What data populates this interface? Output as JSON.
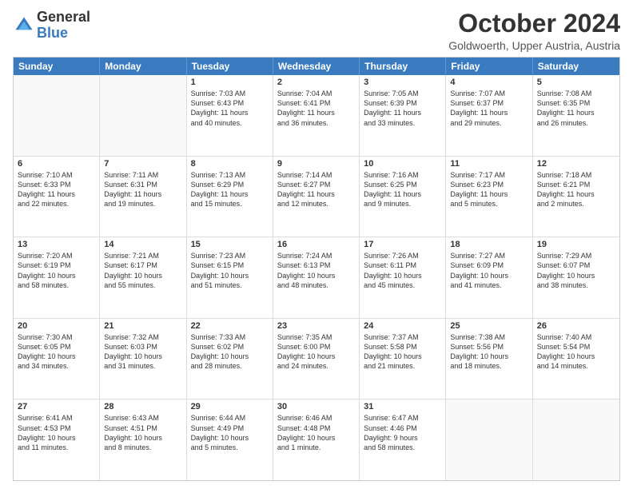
{
  "header": {
    "logo_general": "General",
    "logo_blue": "Blue",
    "month_title": "October 2024",
    "location": "Goldwoerth, Upper Austria, Austria"
  },
  "days_of_week": [
    "Sunday",
    "Monday",
    "Tuesday",
    "Wednesday",
    "Thursday",
    "Friday",
    "Saturday"
  ],
  "weeks": [
    [
      {
        "day": "",
        "empty": true,
        "lines": []
      },
      {
        "day": "",
        "empty": true,
        "lines": []
      },
      {
        "day": "1",
        "lines": [
          "Sunrise: 7:03 AM",
          "Sunset: 6:43 PM",
          "Daylight: 11 hours",
          "and 40 minutes."
        ]
      },
      {
        "day": "2",
        "lines": [
          "Sunrise: 7:04 AM",
          "Sunset: 6:41 PM",
          "Daylight: 11 hours",
          "and 36 minutes."
        ]
      },
      {
        "day": "3",
        "lines": [
          "Sunrise: 7:05 AM",
          "Sunset: 6:39 PM",
          "Daylight: 11 hours",
          "and 33 minutes."
        ]
      },
      {
        "day": "4",
        "lines": [
          "Sunrise: 7:07 AM",
          "Sunset: 6:37 PM",
          "Daylight: 11 hours",
          "and 29 minutes."
        ]
      },
      {
        "day": "5",
        "lines": [
          "Sunrise: 7:08 AM",
          "Sunset: 6:35 PM",
          "Daylight: 11 hours",
          "and 26 minutes."
        ]
      }
    ],
    [
      {
        "day": "6",
        "lines": [
          "Sunrise: 7:10 AM",
          "Sunset: 6:33 PM",
          "Daylight: 11 hours",
          "and 22 minutes."
        ]
      },
      {
        "day": "7",
        "lines": [
          "Sunrise: 7:11 AM",
          "Sunset: 6:31 PM",
          "Daylight: 11 hours",
          "and 19 minutes."
        ]
      },
      {
        "day": "8",
        "lines": [
          "Sunrise: 7:13 AM",
          "Sunset: 6:29 PM",
          "Daylight: 11 hours",
          "and 15 minutes."
        ]
      },
      {
        "day": "9",
        "lines": [
          "Sunrise: 7:14 AM",
          "Sunset: 6:27 PM",
          "Daylight: 11 hours",
          "and 12 minutes."
        ]
      },
      {
        "day": "10",
        "lines": [
          "Sunrise: 7:16 AM",
          "Sunset: 6:25 PM",
          "Daylight: 11 hours",
          "and 9 minutes."
        ]
      },
      {
        "day": "11",
        "lines": [
          "Sunrise: 7:17 AM",
          "Sunset: 6:23 PM",
          "Daylight: 11 hours",
          "and 5 minutes."
        ]
      },
      {
        "day": "12",
        "lines": [
          "Sunrise: 7:18 AM",
          "Sunset: 6:21 PM",
          "Daylight: 11 hours",
          "and 2 minutes."
        ]
      }
    ],
    [
      {
        "day": "13",
        "lines": [
          "Sunrise: 7:20 AM",
          "Sunset: 6:19 PM",
          "Daylight: 10 hours",
          "and 58 minutes."
        ]
      },
      {
        "day": "14",
        "lines": [
          "Sunrise: 7:21 AM",
          "Sunset: 6:17 PM",
          "Daylight: 10 hours",
          "and 55 minutes."
        ]
      },
      {
        "day": "15",
        "lines": [
          "Sunrise: 7:23 AM",
          "Sunset: 6:15 PM",
          "Daylight: 10 hours",
          "and 51 minutes."
        ]
      },
      {
        "day": "16",
        "lines": [
          "Sunrise: 7:24 AM",
          "Sunset: 6:13 PM",
          "Daylight: 10 hours",
          "and 48 minutes."
        ]
      },
      {
        "day": "17",
        "lines": [
          "Sunrise: 7:26 AM",
          "Sunset: 6:11 PM",
          "Daylight: 10 hours",
          "and 45 minutes."
        ]
      },
      {
        "day": "18",
        "lines": [
          "Sunrise: 7:27 AM",
          "Sunset: 6:09 PM",
          "Daylight: 10 hours",
          "and 41 minutes."
        ]
      },
      {
        "day": "19",
        "lines": [
          "Sunrise: 7:29 AM",
          "Sunset: 6:07 PM",
          "Daylight: 10 hours",
          "and 38 minutes."
        ]
      }
    ],
    [
      {
        "day": "20",
        "lines": [
          "Sunrise: 7:30 AM",
          "Sunset: 6:05 PM",
          "Daylight: 10 hours",
          "and 34 minutes."
        ]
      },
      {
        "day": "21",
        "lines": [
          "Sunrise: 7:32 AM",
          "Sunset: 6:03 PM",
          "Daylight: 10 hours",
          "and 31 minutes."
        ]
      },
      {
        "day": "22",
        "lines": [
          "Sunrise: 7:33 AM",
          "Sunset: 6:02 PM",
          "Daylight: 10 hours",
          "and 28 minutes."
        ]
      },
      {
        "day": "23",
        "lines": [
          "Sunrise: 7:35 AM",
          "Sunset: 6:00 PM",
          "Daylight: 10 hours",
          "and 24 minutes."
        ]
      },
      {
        "day": "24",
        "lines": [
          "Sunrise: 7:37 AM",
          "Sunset: 5:58 PM",
          "Daylight: 10 hours",
          "and 21 minutes."
        ]
      },
      {
        "day": "25",
        "lines": [
          "Sunrise: 7:38 AM",
          "Sunset: 5:56 PM",
          "Daylight: 10 hours",
          "and 18 minutes."
        ]
      },
      {
        "day": "26",
        "lines": [
          "Sunrise: 7:40 AM",
          "Sunset: 5:54 PM",
          "Daylight: 10 hours",
          "and 14 minutes."
        ]
      }
    ],
    [
      {
        "day": "27",
        "lines": [
          "Sunrise: 6:41 AM",
          "Sunset: 4:53 PM",
          "Daylight: 10 hours",
          "and 11 minutes."
        ]
      },
      {
        "day": "28",
        "lines": [
          "Sunrise: 6:43 AM",
          "Sunset: 4:51 PM",
          "Daylight: 10 hours",
          "and 8 minutes."
        ]
      },
      {
        "day": "29",
        "lines": [
          "Sunrise: 6:44 AM",
          "Sunset: 4:49 PM",
          "Daylight: 10 hours",
          "and 5 minutes."
        ]
      },
      {
        "day": "30",
        "lines": [
          "Sunrise: 6:46 AM",
          "Sunset: 4:48 PM",
          "Daylight: 10 hours",
          "and 1 minute."
        ]
      },
      {
        "day": "31",
        "lines": [
          "Sunrise: 6:47 AM",
          "Sunset: 4:46 PM",
          "Daylight: 9 hours",
          "and 58 minutes."
        ]
      },
      {
        "day": "",
        "empty": true,
        "lines": []
      },
      {
        "day": "",
        "empty": true,
        "lines": []
      }
    ]
  ]
}
